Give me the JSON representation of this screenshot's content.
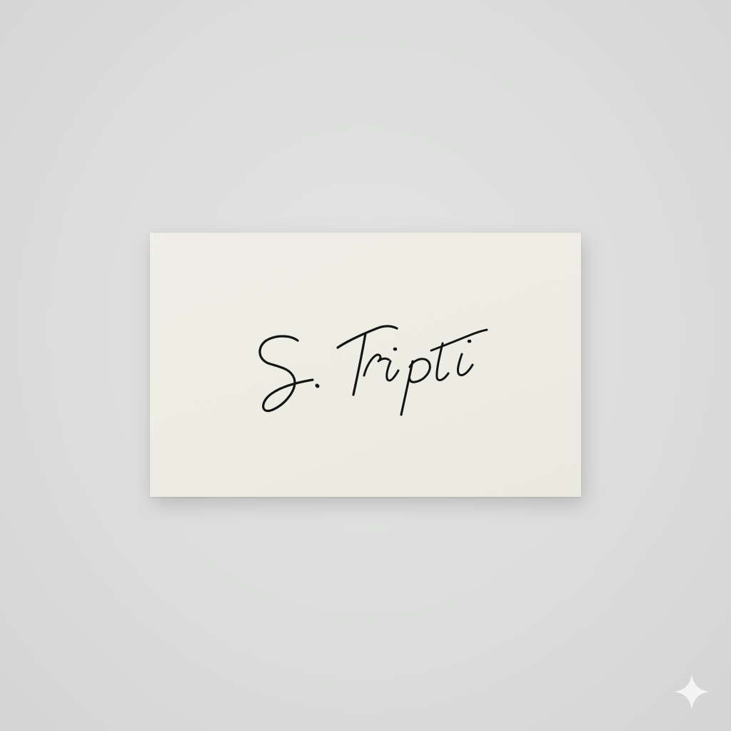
{
  "card": {
    "signature_text": "S. Tripti",
    "paper_color": "#efefe6",
    "ink_color": "#141414"
  },
  "background": {
    "color": "#dcdddc"
  },
  "corner_mark": {
    "icon": "sparkle-icon",
    "color": "#f4f4f4"
  }
}
